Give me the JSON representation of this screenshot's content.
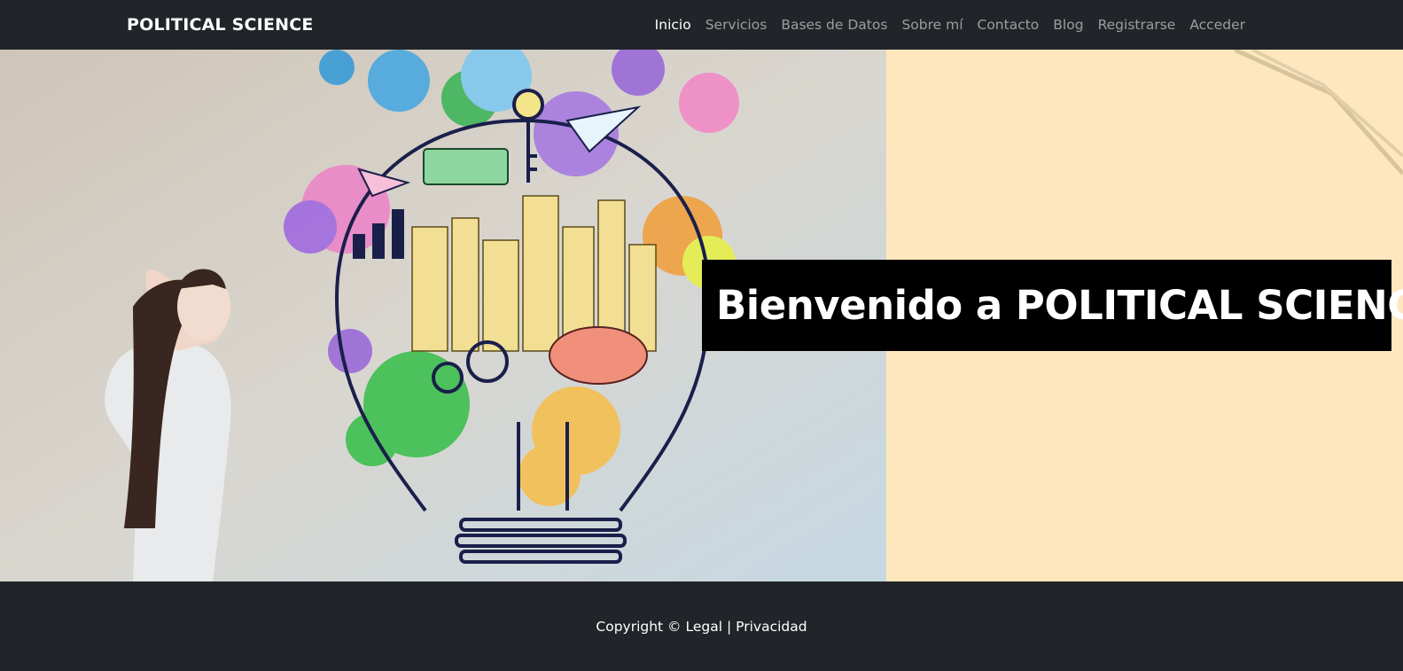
{
  "navbar": {
    "brand": "POLITICAL SCIENCE",
    "links": [
      {
        "label": "Inicio",
        "active": true
      },
      {
        "label": "Servicios"
      },
      {
        "label": "Bases de Datos"
      },
      {
        "label": "Sobre mí"
      },
      {
        "label": "Contacto"
      },
      {
        "label": "Blog"
      },
      {
        "label": "Registrarse"
      },
      {
        "label": "Acceder"
      }
    ]
  },
  "hero": {
    "title": "Bienvenido a POLITICAL SCIENCE",
    "image_subject": "woman-looking-at-lightbulb-illustration",
    "background_color": "#ffe7bd",
    "title_box_color": "#000000"
  },
  "footer": {
    "copyright": "Copyright ©",
    "legal": "Legal",
    "separator": "|",
    "privacy": "Privacidad"
  },
  "colors": {
    "dark": "#212529",
    "nav_muted": "rgba(255,255,255,0.55)",
    "white": "#ffffff"
  }
}
